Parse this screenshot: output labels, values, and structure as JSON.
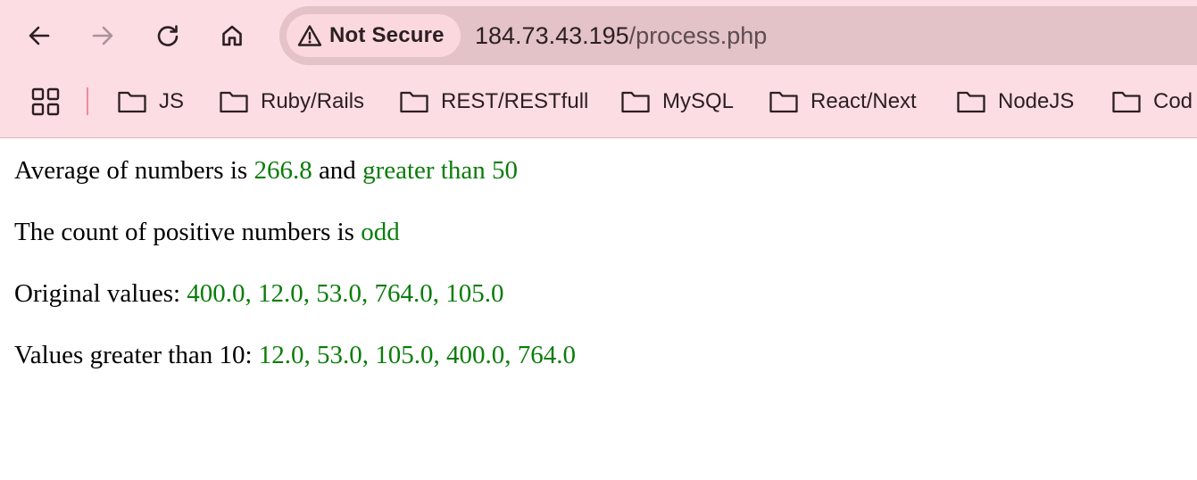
{
  "browser": {
    "security_label": "Not Secure",
    "url_host": "184.73.43.195",
    "url_path": "/process.php",
    "bookmarks": [
      {
        "label": "JS"
      },
      {
        "label": "Ruby/Rails"
      },
      {
        "label": "REST/RESTfull"
      },
      {
        "label": "MySQL"
      },
      {
        "label": "React/Next"
      },
      {
        "label": "NodeJS"
      },
      {
        "label": "Cod"
      }
    ]
  },
  "page": {
    "line1": {
      "prefix": "Average of numbers is ",
      "value": "266.8",
      "middle": " and ",
      "result": "greater than 50"
    },
    "line2": {
      "prefix": "The count of positive numbers is ",
      "result": "odd"
    },
    "line3": {
      "prefix": "Original values: ",
      "values": "400.0, 12.0, 53.0, 764.0, 105.0"
    },
    "line4": {
      "prefix": "Values greater than 10: ",
      "values": "12.0, 53.0, 105.0, 400.0, 764.0"
    }
  },
  "colors": {
    "chrome_background": "#fcdde3",
    "address_bar": "#e3c2c8",
    "highlight_text": "#0a7d0a"
  }
}
